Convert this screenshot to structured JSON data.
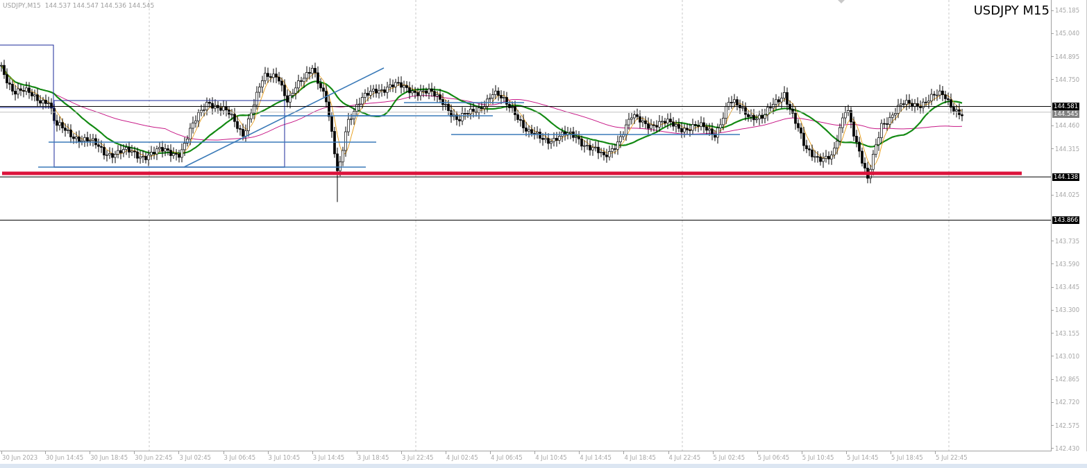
{
  "chart_header": {
    "symbol": "USDJPY,M15",
    "ohlc": "144.537 144.547 144.536 144.545"
  },
  "chart_title": "USDJPY M15",
  "price_axis": [
    "145.185",
    "145.040",
    "144.895",
    "144.750",
    "144.460",
    "144.315",
    "144.025",
    "143.735",
    "143.590",
    "143.445",
    "143.300",
    "143.155",
    "143.010",
    "142.865",
    "142.720",
    "142.575",
    "142.430"
  ],
  "price_labels": [
    {
      "text": "144.581",
      "kind": "line"
    },
    {
      "text": "144.545",
      "kind": "bid"
    },
    {
      "text": "144.138",
      "kind": "line"
    },
    {
      "text": "143.866",
      "kind": "line"
    }
  ],
  "time_axis": [
    "30 Jun 2023",
    "30 Jun 14:45",
    "30 Jun 18:45",
    "30 Jun 22:45",
    "3 Jul 02:45",
    "3 Jul 06:45",
    "3 Jul 10:45",
    "3 Jul 14:45",
    "3 Jul 18:45",
    "3 Jul 22:45",
    "4 Jul 02:45",
    "4 Jul 06:45",
    "4 Jul 10:45",
    "4 Jul 14:45",
    "4 Jul 18:45",
    "4 Jul 22:45",
    "5 Jul 02:45",
    "5 Jul 06:45",
    "5 Jul 10:45",
    "5 Jul 14:45",
    "5 Jul 18:45",
    "5 Jul 22:45"
  ]
}
